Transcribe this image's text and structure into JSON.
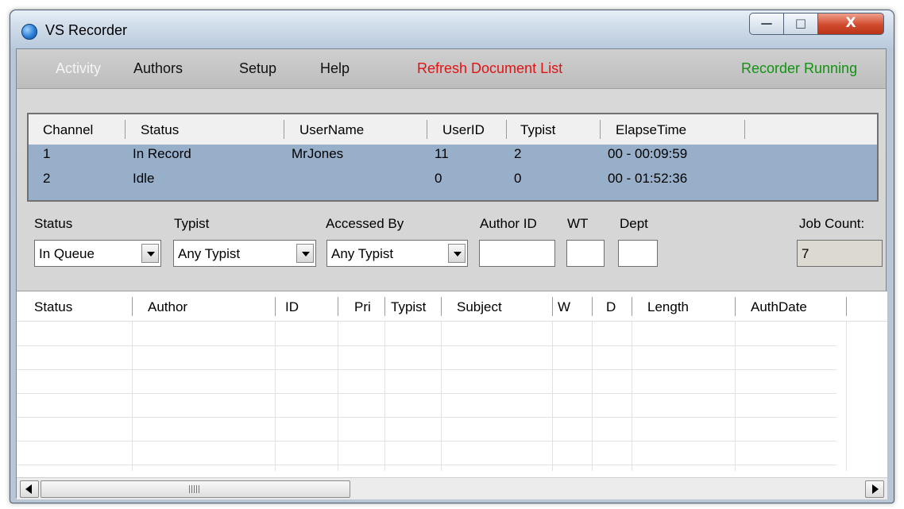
{
  "window": {
    "title": "VS Recorder",
    "controls": {
      "minimize": "—",
      "maximize": "□",
      "close": "X"
    }
  },
  "menu": {
    "activity": "Activity",
    "authors": "Authors",
    "setup": "Setup",
    "help": "Help",
    "refresh": "Refresh Document List",
    "status": "Recorder Running",
    "colors": {
      "refresh": "#e01414",
      "status": "#119311",
      "selected_row": "#98afca"
    }
  },
  "channels": {
    "headers": [
      "Channel",
      "Status",
      "UserName",
      "UserID",
      "Typist",
      "ElapseTime"
    ],
    "rows": [
      [
        "1",
        "In Record",
        "MrJones",
        "11",
        "2",
        "00 - 00:09:59"
      ],
      [
        "2",
        "Idle",
        "",
        "0",
        "0",
        "00 - 01:52:36"
      ]
    ]
  },
  "filters": {
    "status_label": "Status",
    "status_value": "In Queue",
    "typist_label": "Typist",
    "typist_value": "Any Typist",
    "accessed_label": "Accessed By",
    "accessed_value": "Any Typist",
    "author_id_label": "Author ID",
    "wt_label": "WT",
    "dept_label": "Dept",
    "job_count_label": "Job Count:",
    "job_count_value": "7"
  },
  "jobs": {
    "headers": [
      "Status",
      "Author",
      "ID",
      "Pri",
      "Typist",
      "Subject",
      "W",
      "D",
      "Length",
      "AuthDate"
    ],
    "rows": []
  },
  "scrollbar": {
    "grip_icon": "grip-icon",
    "left_icon": "arrow-left-icon",
    "right_icon": "arrow-right-icon"
  }
}
